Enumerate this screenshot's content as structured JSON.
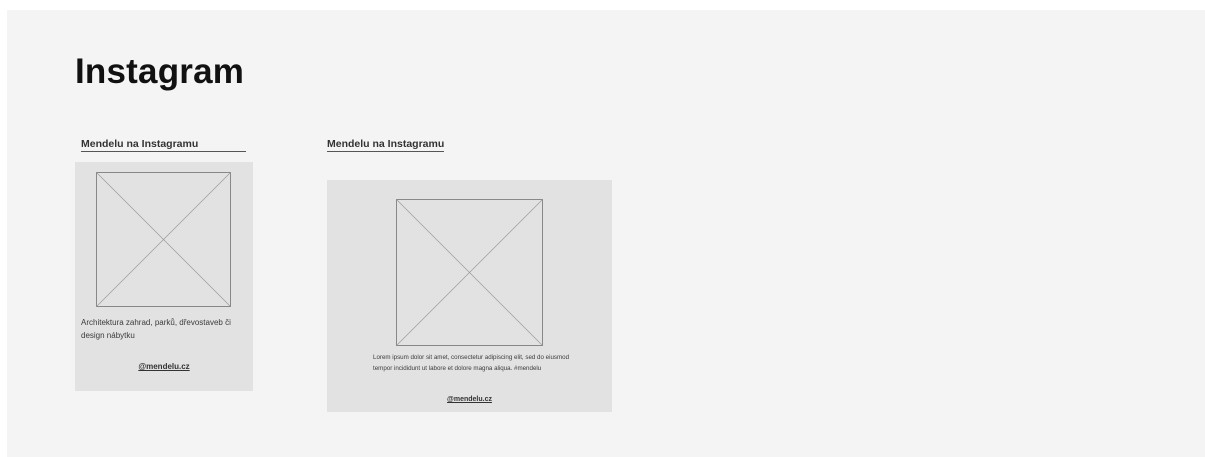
{
  "page": {
    "title": "Instagram"
  },
  "cards": [
    {
      "heading": "Mendelu na Instagramu",
      "caption": "Architektura zahrad, parků,  dřevostaveb či design nábytku",
      "handle": "@mendelu.cz"
    },
    {
      "heading": "Mendelu na Instagramu",
      "caption": "Lorem ipsum dolor sit amet, consectetur adipiscing elit, sed do eiusmod tempor incididunt ut labore et dolore magna aliqua. #mendelu",
      "handle": "@mendelu.cz"
    }
  ],
  "colors": {
    "canvas_background": "#f4f4f4",
    "card_background": "#e2e2e2",
    "placeholder_stroke": "#888888"
  }
}
